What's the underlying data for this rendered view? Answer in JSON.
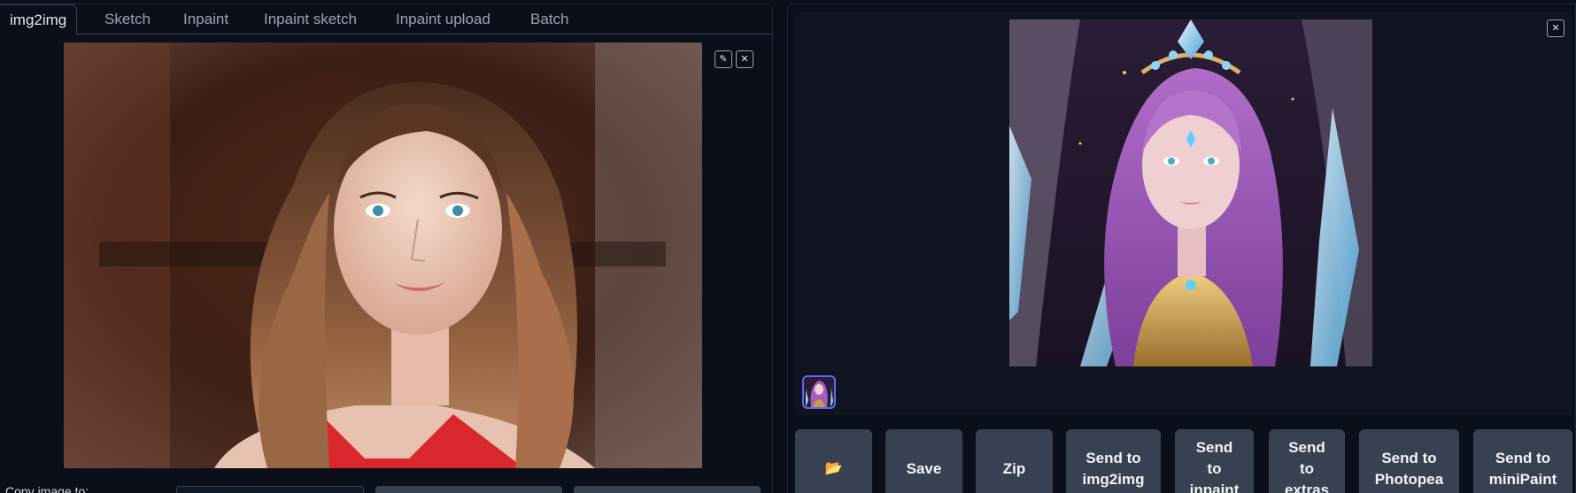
{
  "tabs": [
    {
      "label": "img2img",
      "active": true
    },
    {
      "label": "Sketch",
      "active": false
    },
    {
      "label": "Inpaint",
      "active": false
    },
    {
      "label": "Inpaint sketch",
      "active": false
    },
    {
      "label": "Inpaint upload",
      "active": false
    },
    {
      "label": "Batch",
      "active": false
    }
  ],
  "input_image": {
    "edit_icon": "pencil-icon",
    "clear_icon": "close-icon",
    "edit_glyph": "✎",
    "clear_glyph": "✕"
  },
  "copy_image": {
    "label": "Copy image to:"
  },
  "output": {
    "close_glyph": "✕",
    "actions": {
      "folder_glyph": "📂",
      "save": "Save",
      "zip": "Zip",
      "send_img2img": "Send to\nimg2img",
      "send_inpaint": "Send\nto\ninpaint",
      "send_extras": "Send\nto\nextras",
      "send_photopea": "Send to\nPhotopea",
      "send_minipaint": "Send to\nminiPaint"
    }
  },
  "colors": {
    "background": "#0b0f19",
    "button": "#374151",
    "accent": "#6366f1",
    "folder": "#f5b82e"
  }
}
